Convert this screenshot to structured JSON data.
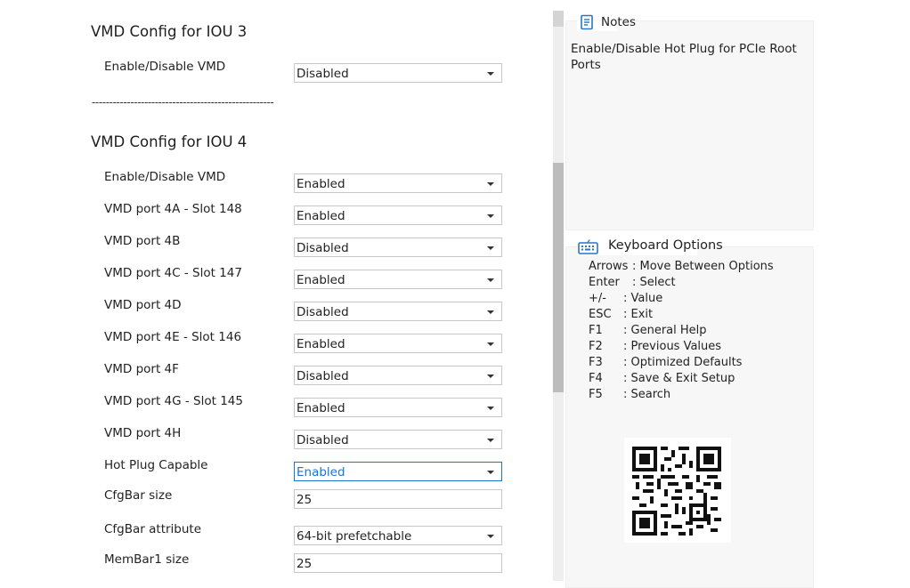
{
  "sections": [
    {
      "title": "VMD Config for IOU 3"
    },
    {
      "title": "VMD Config for IOU 4"
    }
  ],
  "separator": "----------------------------------------------------",
  "settings": [
    {
      "label": "Enable/Disable VMD",
      "value": "Disabled",
      "type": "dropdown"
    },
    {
      "label": "Enable/Disable VMD",
      "value": "Enabled",
      "type": "dropdown"
    },
    {
      "label": "VMD port 4A - Slot 148",
      "value": "Enabled",
      "type": "dropdown"
    },
    {
      "label": "VMD port 4B",
      "value": "Disabled",
      "type": "dropdown"
    },
    {
      "label": "VMD port 4C - Slot 147",
      "value": "Enabled",
      "type": "dropdown"
    },
    {
      "label": "VMD port 4D",
      "value": "Disabled",
      "type": "dropdown"
    },
    {
      "label": "VMD port 4E - Slot 146",
      "value": "Enabled",
      "type": "dropdown"
    },
    {
      "label": "VMD port 4F",
      "value": "Disabled",
      "type": "dropdown"
    },
    {
      "label": "VMD port 4G - Slot 145",
      "value": "Enabled",
      "type": "dropdown"
    },
    {
      "label": "VMD port 4H",
      "value": "Disabled",
      "type": "dropdown"
    },
    {
      "label": "Hot Plug Capable",
      "value": "Enabled",
      "type": "dropdown",
      "selected": true
    },
    {
      "label": "CfgBar size",
      "value": "25",
      "type": "text"
    },
    {
      "label": "CfgBar attribute",
      "value": "64-bit prefetchable",
      "type": "dropdown"
    },
    {
      "label": "MemBar1 size",
      "value": "25",
      "type": "text"
    }
  ],
  "notes": {
    "title": "Notes",
    "icon": "notes-icon",
    "text": "Enable/Disable Hot Plug for PCIe Root Ports"
  },
  "keyboard": {
    "title": "Keyboard Options",
    "icon": "keyboard-icon",
    "items": [
      {
        "key": "Arrows",
        "desc": ": Move Between Options"
      },
      {
        "key": "Enter",
        "desc": ": Select"
      },
      {
        "key": "+/-",
        "desc": ": Value"
      },
      {
        "key": "ESC",
        "desc": ": Exit"
      },
      {
        "key": "F1",
        "desc": ": General Help"
      },
      {
        "key": "F2",
        "desc": ": Previous Values"
      },
      {
        "key": "F3",
        "desc": ": Optimized Defaults"
      },
      {
        "key": "F4",
        "desc": ": Save & Exit Setup"
      },
      {
        "key": "F5",
        "desc": ": Search"
      }
    ]
  },
  "qr": {
    "icon": "qr-code-icon"
  },
  "colors": {
    "selected_border": "#1a75d2",
    "scroll_thumb": "#bcbcbc",
    "panel_bg": "#f7f7f7"
  }
}
